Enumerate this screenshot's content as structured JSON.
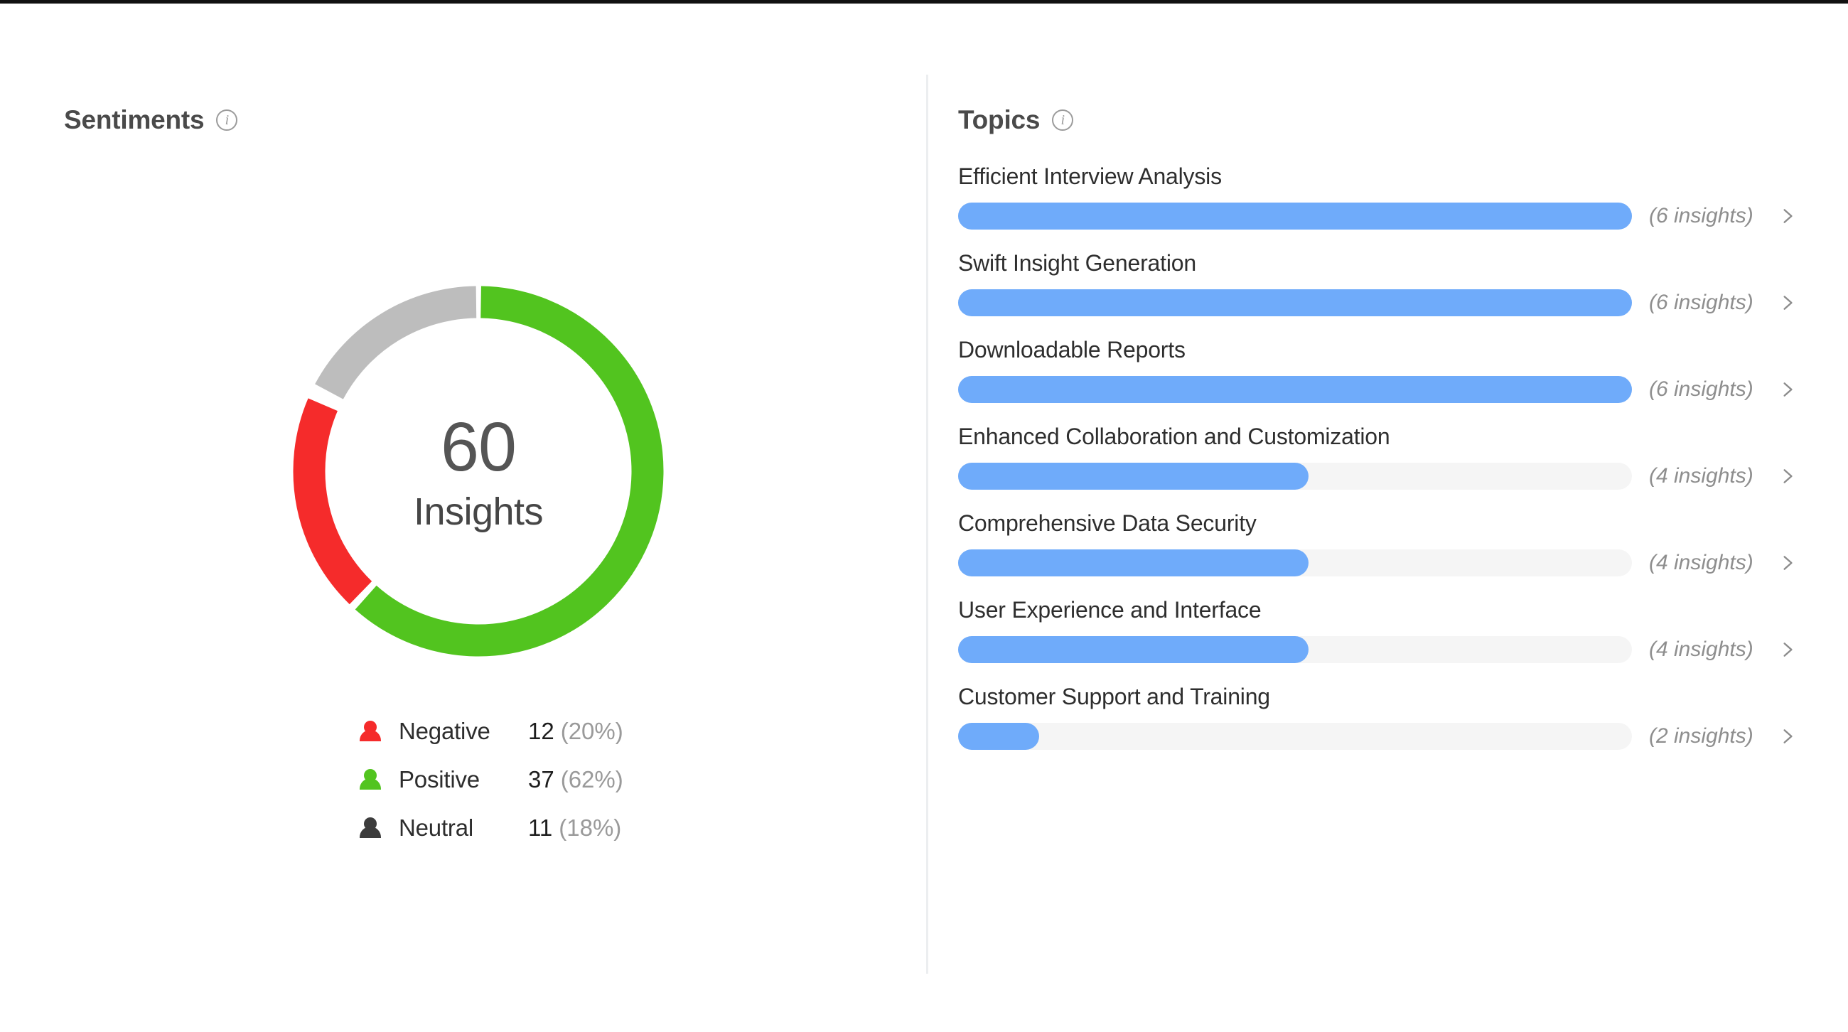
{
  "sentiments": {
    "title": "Sentiments",
    "info_icon": "info-icon",
    "center_total": "60",
    "center_label": "Insights",
    "legend": [
      {
        "name": "Negative",
        "count": "12",
        "percent": "(20%)",
        "color": "#f52b2b",
        "icon": "person-icon"
      },
      {
        "name": "Positive",
        "count": "37",
        "percent": "(62%)",
        "color": "#52c41f",
        "icon": "person-icon"
      },
      {
        "name": "Neutral",
        "count": "11",
        "percent": "(18%)",
        "color": "#3c3c3c",
        "icon": "person-icon"
      }
    ]
  },
  "topics": {
    "title": "Topics",
    "info_icon": "info-icon",
    "chevron_icon": "chevron-right-icon",
    "bar_color": "#6fabfa",
    "track_color": "#f5f5f5",
    "items": [
      {
        "name": "Efficient Interview Analysis",
        "count": 6,
        "count_label": "(6 insights)",
        "fill_pct": 100
      },
      {
        "name": "Swift Insight Generation",
        "count": 6,
        "count_label": "(6 insights)",
        "fill_pct": 100
      },
      {
        "name": "Downloadable Reports",
        "count": 6,
        "count_label": "(6 insights)",
        "fill_pct": 100
      },
      {
        "name": "Enhanced Collaboration and Customization",
        "count": 4,
        "count_label": "(4 insights)",
        "fill_pct": 52
      },
      {
        "name": "Comprehensive Data Security",
        "count": 4,
        "count_label": "(4 insights)",
        "fill_pct": 52
      },
      {
        "name": "User Experience and Interface",
        "count": 4,
        "count_label": "(4 insights)",
        "fill_pct": 52
      },
      {
        "name": "Customer Support and Training",
        "count": 2,
        "count_label": "(2 insights)",
        "fill_pct": 12
      }
    ]
  },
  "chart_data": {
    "type": "pie",
    "title": "Sentiments",
    "variant": "donut",
    "total": 60,
    "total_label": "Insights",
    "start_angle_deg": 0,
    "direction": "clockwise",
    "categories": [
      "Positive",
      "Negative",
      "Neutral"
    ],
    "values": [
      37,
      12,
      11
    ],
    "percents": [
      62,
      20,
      18
    ],
    "colors": [
      "#52c41f",
      "#f52b2b",
      "#bdbdbd"
    ],
    "legend_position": "below",
    "legend_order": [
      "Negative",
      "Positive",
      "Neutral"
    ],
    "gap_deg": 3,
    "secondary_chart": {
      "type": "bar",
      "orientation": "horizontal",
      "title": "Topics",
      "categories": [
        "Efficient Interview Analysis",
        "Swift Insight Generation",
        "Downloadable Reports",
        "Enhanced Collaboration and Customization",
        "Comprehensive Data Security",
        "User Experience and Interface",
        "Customer Support and Training"
      ],
      "values": [
        6,
        6,
        6,
        4,
        4,
        4,
        2
      ],
      "value_labels": [
        "(6 insights)",
        "(6 insights)",
        "(6 insights)",
        "(4 insights)",
        "(4 insights)",
        "(4 insights)",
        "(2 insights)"
      ],
      "xlabel": "",
      "ylabel": "",
      "xlim": [
        0,
        6
      ],
      "grid": false,
      "bar_color": "#6fabfa",
      "track_color": "#f5f5f5"
    }
  }
}
